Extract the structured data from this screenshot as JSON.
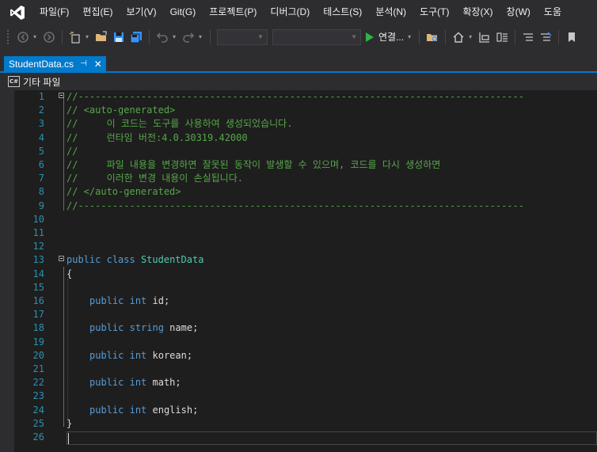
{
  "menu": [
    "파일(F)",
    "편집(E)",
    "보기(V)",
    "Git(G)",
    "프로젝트(P)",
    "디버그(D)",
    "테스트(S)",
    "분석(N)",
    "도구(T)",
    "확장(X)",
    "창(W)",
    "도움"
  ],
  "toolbar": {
    "run_label": "연결..."
  },
  "tab": {
    "title": "StudentData.cs",
    "pin": "⊣",
    "close": "✕"
  },
  "navbar": {
    "project_label": "기타 파일",
    "lang_badge": "C#"
  },
  "editor": {
    "lines": [
      {
        "num": "1",
        "text": "//------------------------------------------------------------------------------"
      },
      {
        "num": "2",
        "text": "// <auto-generated>"
      },
      {
        "num": "3",
        "text": "//     이 코드는 도구를 사용하여 생성되었습니다."
      },
      {
        "num": "4",
        "text": "//     런타임 버전:4.0.30319.42000"
      },
      {
        "num": "5",
        "text": "//"
      },
      {
        "num": "6",
        "text": "//     파일 내용을 변경하면 잘못된 동작이 발생할 수 있으며, 코드를 다시 생성하면"
      },
      {
        "num": "7",
        "text": "//     이러한 변경 내용이 손실됩니다."
      },
      {
        "num": "8",
        "text": "// </auto-generated>"
      },
      {
        "num": "9",
        "text": "//------------------------------------------------------------------------------"
      },
      {
        "num": "10",
        "text": ""
      },
      {
        "num": "11",
        "text": ""
      },
      {
        "num": "12",
        "text": ""
      },
      {
        "num": "13",
        "kw1": "public",
        "kw2": "class",
        "type": "StudentData"
      },
      {
        "num": "14",
        "text": "{"
      },
      {
        "num": "15",
        "text": ""
      },
      {
        "num": "16",
        "kw1": "public",
        "kw2": "int",
        "rest": " id;"
      },
      {
        "num": "17",
        "text": ""
      },
      {
        "num": "18",
        "kw1": "public",
        "kw2": "string",
        "rest": " name;"
      },
      {
        "num": "19",
        "text": ""
      },
      {
        "num": "20",
        "kw1": "public",
        "kw2": "int",
        "rest": " korean;"
      },
      {
        "num": "21",
        "text": ""
      },
      {
        "num": "22",
        "kw1": "public",
        "kw2": "int",
        "rest": " math;"
      },
      {
        "num": "23",
        "text": ""
      },
      {
        "num": "24",
        "kw1": "public",
        "kw2": "int",
        "rest": " english;"
      },
      {
        "num": "25",
        "text": "}"
      },
      {
        "num": "26",
        "text": ""
      }
    ]
  }
}
